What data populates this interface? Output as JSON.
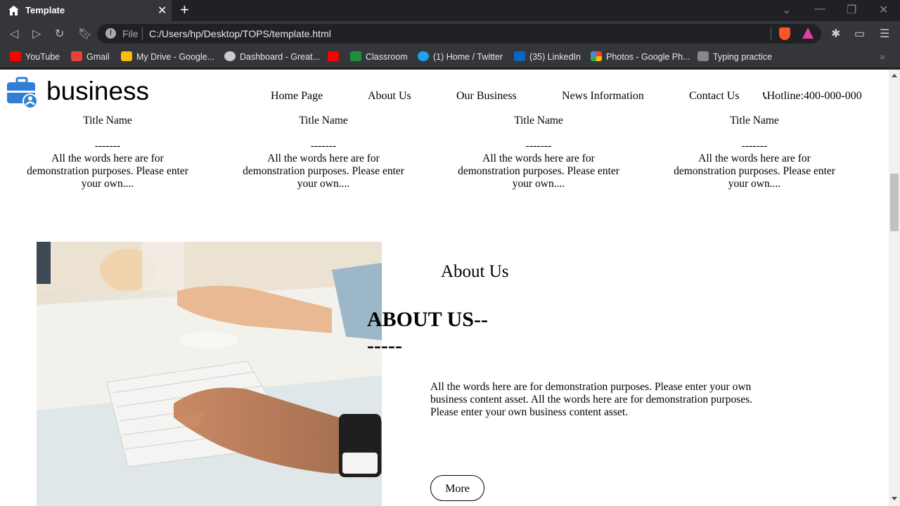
{
  "browser": {
    "tab_title": "Template",
    "url_scheme_label": "File",
    "url": "C:/Users/hp/Desktop/TOPS/template.html",
    "bookmarks": [
      {
        "label": "YouTube",
        "icon": "youtube-icon",
        "color": "#ff0000"
      },
      {
        "label": "Gmail",
        "icon": "gmail-icon",
        "color": "#ea4335"
      },
      {
        "label": "My Drive - Google...",
        "icon": "google-drive-icon",
        "color": "#fbbc04"
      },
      {
        "label": "Dashboard - Great...",
        "icon": "globe-icon",
        "color": "#cccccc"
      },
      {
        "label": "",
        "icon": "youtube-icon",
        "color": "#ff0000"
      },
      {
        "label": "Classroom",
        "icon": "classroom-icon",
        "color": "#1e8e3e"
      },
      {
        "label": "(1) Home / Twitter",
        "icon": "twitter-icon",
        "color": "#1da1f2"
      },
      {
        "label": "(35) LinkedIn",
        "icon": "linkedin-icon",
        "color": "#0a66c2"
      },
      {
        "label": "Photos - Google Ph...",
        "icon": "google-photos-icon",
        "color": "#f4b400"
      },
      {
        "label": "Typing practice",
        "icon": "typing-icon",
        "color": "#888888"
      }
    ]
  },
  "site": {
    "logo_text": "business",
    "nav": [
      "Home Page",
      "About Us",
      "Our Business",
      "News Information",
      "Contact Us"
    ],
    "hotline": "Hotline:400-000-000",
    "cards": [
      {
        "title": "Title Name",
        "divider": "-------",
        "text": "All the words here are for demonstration purposes. Please enter your own...."
      },
      {
        "title": "Title Name",
        "divider": "-------",
        "text": "All the words here are for demonstration purposes. Please enter your own...."
      },
      {
        "title": "Title Name",
        "divider": "-------",
        "text": "All the words here are for demonstration purposes. Please enter your own...."
      },
      {
        "title": "Title Name",
        "divider": "-------",
        "text": "All the words here are for demonstration purposes. Please enter your own...."
      }
    ],
    "about": {
      "heading": "About Us",
      "big_heading": "ABOUT US--",
      "big_dashes": "-----",
      "text": "All the words here are for demonstration purposes. Please enter your own business content asset. All the words here are for demonstration purposes. Please enter your own business content asset.",
      "more_button": "More"
    }
  },
  "colors": {
    "chrome_dark": "#202124",
    "chrome_bar": "#35363a",
    "logo_blue": "#2f7fd6"
  }
}
